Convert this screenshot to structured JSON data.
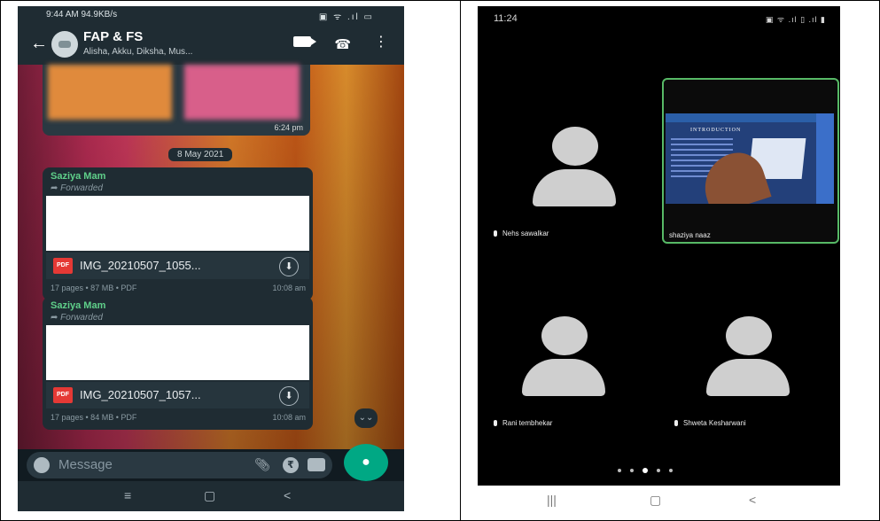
{
  "whatsapp": {
    "status_bar": {
      "time": "9:44 AM",
      "speed": "94.9KB/s",
      "icons": "▣ ᯤ .ıl ▭"
    },
    "header": {
      "title": "FAP & FS",
      "subtitle": "Alisha, Akku, Diksha, Mus...",
      "back_icon": "←",
      "video_icon": "video-call",
      "call_icon": "☎",
      "menu_icon": "⋮"
    },
    "image_message": {
      "time": "6:24 pm"
    },
    "date_separator": "8 May 2021",
    "documents": [
      {
        "sender": "Saziya Mam",
        "forwarded": "Forwarded",
        "badge": "PDF",
        "file_name": "IMG_20210507_1055...",
        "meta": "17 pages • 87 MB • PDF",
        "time": "10:08 am"
      },
      {
        "sender": "Saziya Mam",
        "forwarded": "Forwarded",
        "badge": "PDF",
        "file_name": "IMG_20210507_1057...",
        "meta": "17 pages • 84 MB • PDF",
        "time": "10:08 am"
      }
    ],
    "input": {
      "placeholder": "Message"
    },
    "nav": {
      "recents": "≡",
      "home": "▢",
      "back": "<"
    }
  },
  "meet": {
    "status_bar": {
      "time": "11:24",
      "icons": "▣ ᯤ .ıl ▯ .ıl ▮"
    },
    "participants": [
      {
        "name": "Nehs sawalkar"
      },
      {
        "name": "shaziya naaz"
      },
      {
        "name": "Rani tembhekar"
      },
      {
        "name": "Shweta Kesharwani"
      }
    ],
    "shared_slide_title": "INTRODUCTION",
    "page_dots": {
      "count": 5,
      "active_index": 2
    },
    "nav": {
      "recents": "|||",
      "home": "▢",
      "back": "<"
    }
  }
}
